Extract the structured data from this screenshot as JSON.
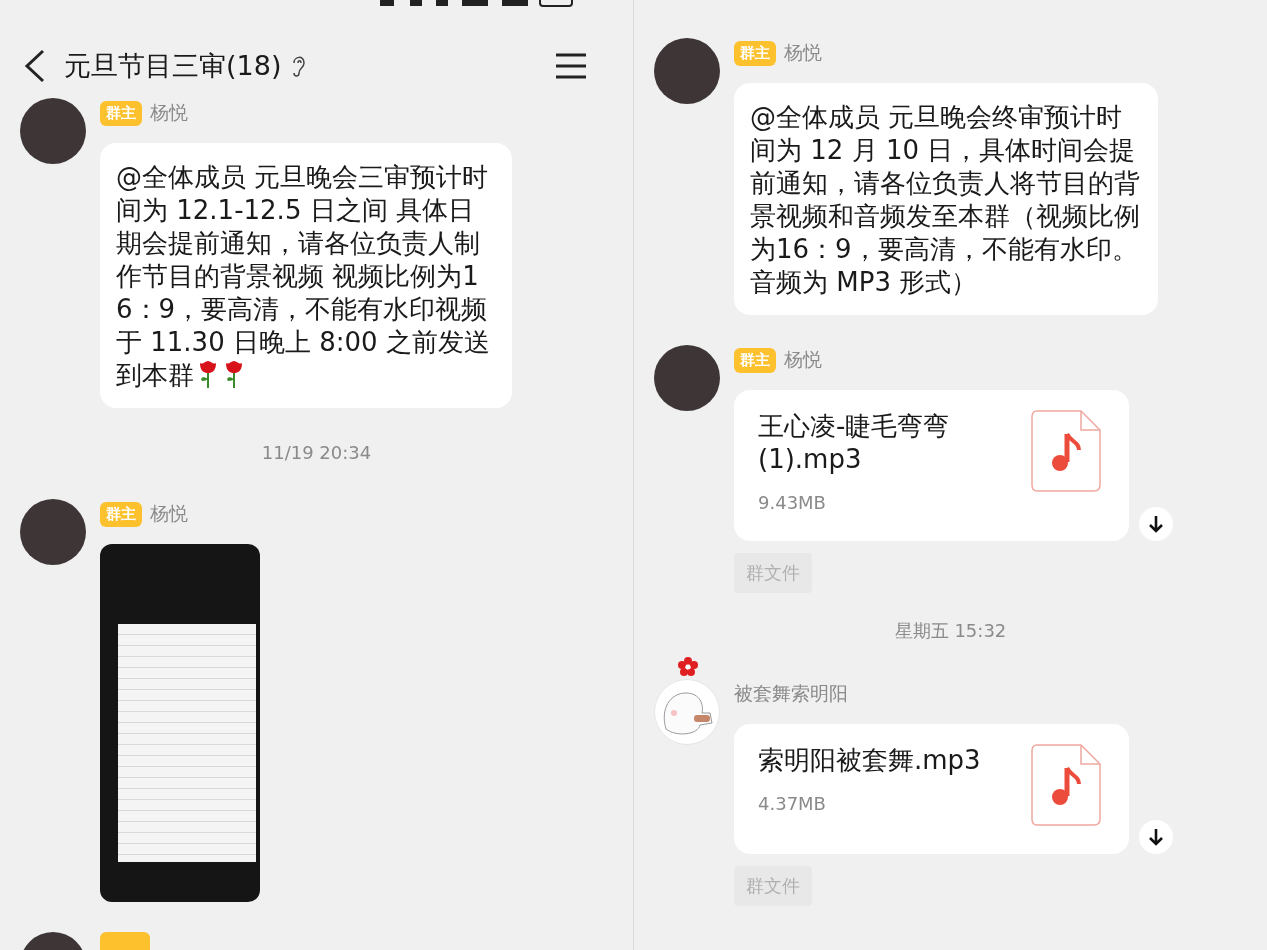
{
  "panels": [
    {
      "header": {
        "title": "元旦节目三审(18)"
      },
      "items": [
        {
          "kind": "text",
          "sender": "杨悦",
          "role": "群主",
          "cartoon_avatar": false,
          "text": "@全体成员 元旦晚会三审预计时间为 12.1-12.5 日之间 具体日期会提前通知，请各位负责人制作节目的背景视频  视频比例为16：9，要高清，不能有水印视频于 11.30 日晚上 8:00 之前发送到本群",
          "emojis": [
            {
              "kind": "rose"
            },
            {
              "kind": "rose"
            }
          ]
        },
        {
          "kind": "time",
          "text": "11/19 20:34"
        },
        {
          "kind": "image",
          "sender": "杨悦",
          "role": "群主",
          "cartoon_avatar": false
        },
        {
          "kind": "cut",
          "cartoon_avatar": false
        }
      ]
    },
    {
      "items": [
        {
          "kind": "text",
          "sender": "杨悦",
          "role": "群主",
          "cartoon_avatar": false,
          "text": "@全体成员  元旦晚会终审预计时间为 12 月 10 日，具体时间会提前通知，请各位负责人将节目的背景视频和音频发至本群（视频比例为16：9，要高清，不能有水印。音频为 MP3 形式）"
        },
        {
          "kind": "file",
          "sender": "杨悦",
          "role": "群主",
          "cartoon_avatar": false,
          "name": "王心凌-睫毛弯弯(1).mp3",
          "size": "9.43MB",
          "source": "群文件"
        },
        {
          "kind": "time",
          "text": "星期五 15:32"
        },
        {
          "kind": "file",
          "sender": "被套舞索明阳",
          "cartoon_avatar": true,
          "name": "索明阳被套舞.mp3",
          "size": "4.37MB",
          "source": "群文件"
        }
      ]
    }
  ]
}
